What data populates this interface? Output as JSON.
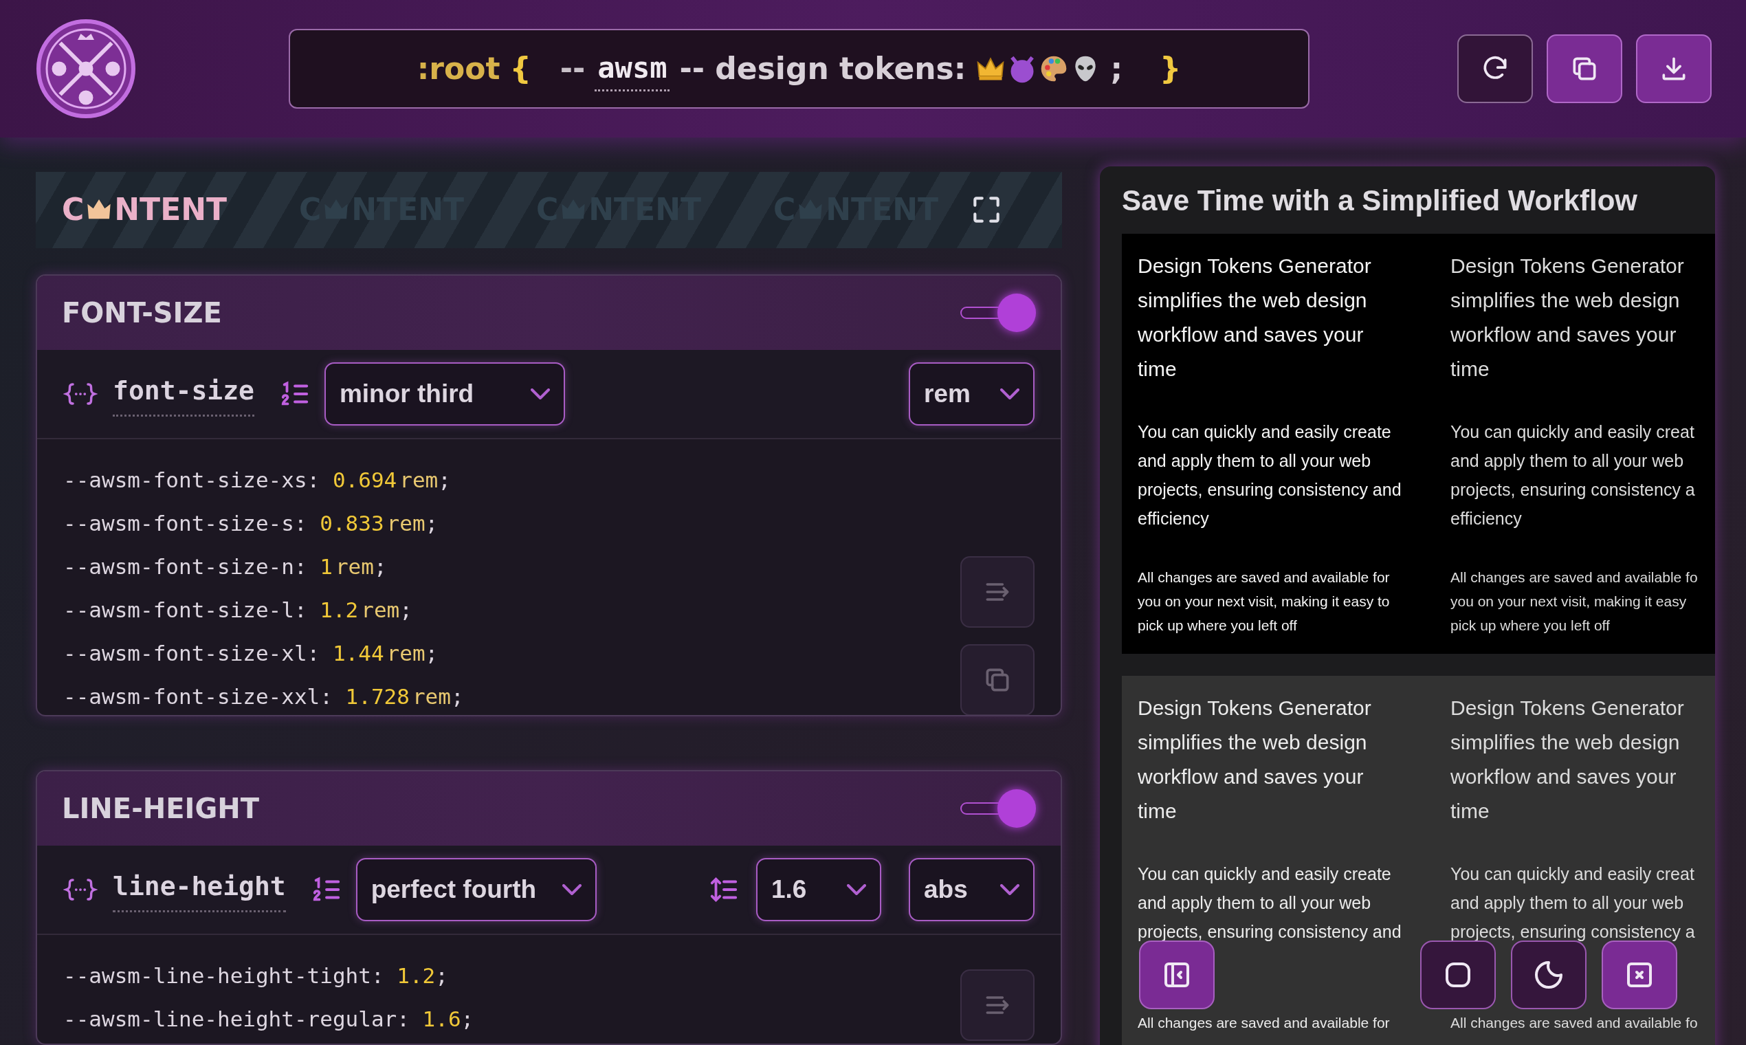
{
  "header": {
    "root": ":root",
    "brace_open": "{",
    "dash": "--",
    "prefix": "awsm",
    "suffix": "-- design tokens:",
    "semicolon": ";",
    "brace_close": "}",
    "buttons": [
      {
        "kind": "refresh",
        "active": false
      },
      {
        "kind": "copy",
        "active": true
      },
      {
        "kind": "download",
        "active": true
      }
    ]
  },
  "banner": {
    "items": [
      {
        "start": "C",
        "end": "NTENT",
        "faded": false
      },
      {
        "start": "C",
        "end": "NTENT",
        "faded": true
      },
      {
        "start": "C",
        "end": "NTENT",
        "faded": true
      },
      {
        "start": "C",
        "end": "NTENT",
        "faded": true
      }
    ]
  },
  "sections": [
    {
      "title": "FONT-SIZE",
      "enabled": true,
      "token": "font-size",
      "controls": [
        {
          "kind": "scale",
          "value": "minor third"
        },
        {
          "kind": "unit",
          "value": "rem"
        }
      ],
      "lines": [
        {
          "name": "--awsm-font-size-xs:",
          "value": "0.694",
          "unit": "rem",
          "end": ";"
        },
        {
          "name": "--awsm-font-size-s:",
          "value": "0.833",
          "unit": "rem",
          "end": ";"
        },
        {
          "name": "--awsm-font-size-n:",
          "value": "1",
          "unit": "rem",
          "end": ";"
        },
        {
          "name": "--awsm-font-size-l:",
          "value": "1.2",
          "unit": "rem",
          "end": ";"
        },
        {
          "name": "--awsm-font-size-xl:",
          "value": "1.44",
          "unit": "rem",
          "end": ";"
        },
        {
          "name": "--awsm-font-size-xxl:",
          "value": "1.728",
          "unit": "rem",
          "end": ";"
        }
      ],
      "actions": [
        {
          "kind": "wrap"
        },
        {
          "kind": "copy"
        }
      ]
    },
    {
      "title": "LINE-HEIGHT",
      "enabled": true,
      "token": "line-height",
      "controls": [
        {
          "kind": "scale",
          "value": "perfect fourth"
        },
        {
          "kind": "base",
          "value": "1.6"
        },
        {
          "kind": "unit",
          "value": "abs"
        }
      ],
      "lines": [
        {
          "name": "--awsm-line-height-tight:",
          "value": "1.2",
          "end": ";"
        },
        {
          "name": "--awsm-line-height-regular:",
          "value": "1.6",
          "end": ";"
        }
      ],
      "actions": [
        {
          "kind": "wrap"
        }
      ]
    }
  ],
  "preview": {
    "title": "Save Time with a Simplified Workflow",
    "blocks": [
      {
        "kind": "dark",
        "columns": [
          {
            "heading": [
              "Design Tokens Generator",
              "simplifies the web design",
              "workflow and saves your",
              "time"
            ],
            "body": [
              "You can quickly and easily create",
              "and apply them to all your web",
              "projects, ensuring consistency and",
              "efficiency"
            ],
            "note": [
              "All changes are saved and available for",
              "you on your next visit, making it easy to",
              "pick up where you left off"
            ]
          },
          {
            "heading": [
              "Design Tokens Generator",
              "simplifies the web design",
              "workflow and saves your",
              "time"
            ],
            "body": [
              "You can quickly and easily creat",
              "and apply them to all your web",
              "projects, ensuring consistency a",
              "efficiency"
            ],
            "note": [
              "All changes are saved and available fo",
              "you on your next visit, making it easy",
              "pick up where you left off"
            ]
          }
        ]
      },
      {
        "kind": "gray",
        "columns": [
          {
            "heading": [
              "Design Tokens Generator",
              "simplifies the web design",
              "workflow and saves your",
              "time"
            ],
            "body": [
              "You can quickly and easily create",
              "and apply them to all your web",
              "projects, ensuring consistency and"
            ],
            "note": [
              "All changes are saved and available for"
            ]
          },
          {
            "heading": [
              "Design Tokens Generator",
              "simplifies the web design",
              "workflow and saves your",
              "time"
            ],
            "body": [
              "You can quickly and easily creat",
              "and apply them to all your web",
              "projects, ensuring consistency a"
            ],
            "note": [
              "All changes are saved and available fo"
            ]
          }
        ]
      }
    ],
    "dock": [
      {
        "kind": "sidebar",
        "active": true
      },
      {
        "kind": "square",
        "active": false
      },
      {
        "kind": "moon",
        "active": false
      },
      {
        "kind": "close",
        "active": true
      }
    ]
  }
}
